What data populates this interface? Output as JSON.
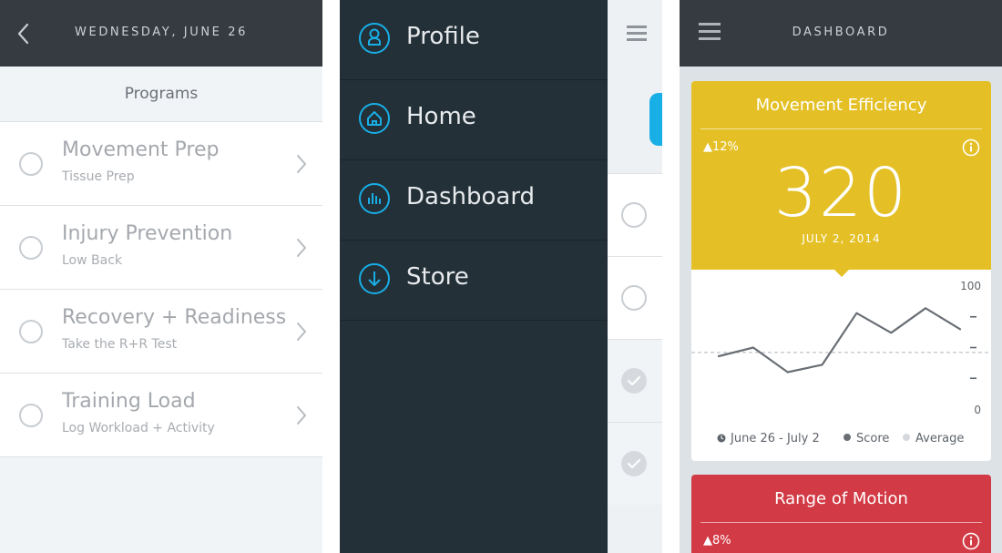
{
  "programs_screen": {
    "header_title": "WEDNESDAY, JUNE 26",
    "section_title": "Programs",
    "items": [
      {
        "title": "Movement Prep",
        "subtitle": "Tissue Prep"
      },
      {
        "title": "Injury Prevention",
        "subtitle": "Low Back"
      },
      {
        "title": "Recovery + Readiness",
        "subtitle": "Take the R+R Test"
      },
      {
        "title": "Training Load",
        "subtitle": "Log Workload + Activity"
      }
    ]
  },
  "menu_screen": {
    "items": [
      {
        "label": "Profile",
        "icon": "profile-icon"
      },
      {
        "label": "Home",
        "icon": "home-icon"
      },
      {
        "label": "Dashboard",
        "icon": "dashboard-icon"
      },
      {
        "label": "Store",
        "icon": "download-icon"
      }
    ],
    "accent_color": "#18aee6"
  },
  "dashboard_screen": {
    "header_title": "DASHBOARD",
    "cards": [
      {
        "title": "Movement Efficiency",
        "change": "▲12%",
        "value": "320",
        "date": "JULY 2, 2014",
        "color": "#e4c026"
      },
      {
        "title": "Range of Motion",
        "change": "▲8%",
        "color": "#d23a45"
      }
    ],
    "legend": {
      "range": "June 26 - July 2",
      "score": "Score",
      "average": "Average"
    }
  },
  "chart_data": {
    "type": "line",
    "title": "",
    "xlabel": "",
    "ylabel": "",
    "ylim": [
      0,
      100
    ],
    "y_tick_labels": [
      "100",
      "0"
    ],
    "grid": false,
    "legend_position": "bottom",
    "series": [
      {
        "name": "Score",
        "values": [
          43,
          50,
          30,
          36,
          78,
          62,
          82,
          65
        ]
      }
    ],
    "average": 46
  }
}
